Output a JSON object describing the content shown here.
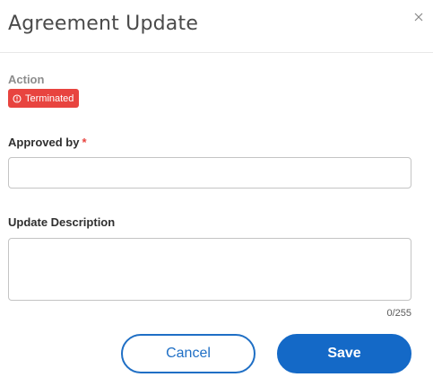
{
  "dialog": {
    "title": "Agreement Update",
    "close_icon": "close-icon"
  },
  "action": {
    "label": "Action",
    "badge": {
      "icon": "alert-circle-icon",
      "text": "Terminated",
      "color": "#e8443f"
    }
  },
  "approved_by": {
    "label": "Approved by",
    "required_marker": "*",
    "value": "",
    "placeholder": ""
  },
  "update_description": {
    "label": "Update Description",
    "value": "",
    "placeholder": "",
    "counter": "0/255"
  },
  "buttons": {
    "cancel_label": "Cancel",
    "save_label": "Save"
  },
  "colors": {
    "primary": "#1469c7",
    "danger": "#e8443f",
    "border": "#c4c4c4"
  }
}
